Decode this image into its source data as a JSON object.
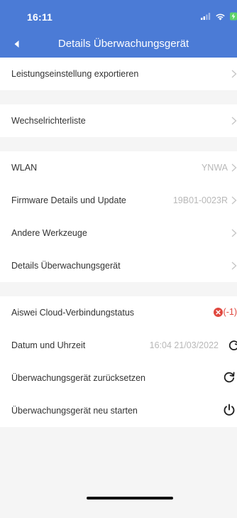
{
  "status_bar": {
    "time": "16:11"
  },
  "nav": {
    "title": "Details Überwachungsgerät",
    "back_icon": "chevron-left-filled-icon"
  },
  "groups": [
    {
      "rows": [
        {
          "label": "Leistungseinstellung exportieren",
          "value": "",
          "accessory": "chevron"
        }
      ]
    },
    {
      "rows": [
        {
          "label": "Wechselrichterliste",
          "value": "",
          "accessory": "chevron"
        }
      ]
    },
    {
      "rows": [
        {
          "label": "WLAN",
          "value": "YNWA",
          "accessory": "chevron"
        },
        {
          "label": "Firmware Details und Update",
          "value": "19B01-0023R",
          "accessory": "chevron"
        },
        {
          "label": "Andere Werkzeuge",
          "value": "",
          "accessory": "chevron"
        },
        {
          "label": "Details Überwachungsgerät",
          "value": "",
          "accessory": "chevron"
        }
      ]
    },
    {
      "rows": [
        {
          "label": "Aiswei Cloud-Verbindungstatus",
          "value": "(-1)",
          "accessory": "error-status"
        },
        {
          "label": "Datum und Uhrzeit",
          "value": "16:04 21/03/2022",
          "accessory": "refresh-icon"
        },
        {
          "label": "Überwachungsgerät zurücksetzen",
          "value": "",
          "accessory": "reset-icon"
        },
        {
          "label": "Überwachungsgerät neu starten",
          "value": "",
          "accessory": "power-icon"
        }
      ]
    }
  ],
  "colors": {
    "header": "#4b7bd6",
    "background": "#f5f5f5",
    "error": "#e0483f"
  }
}
